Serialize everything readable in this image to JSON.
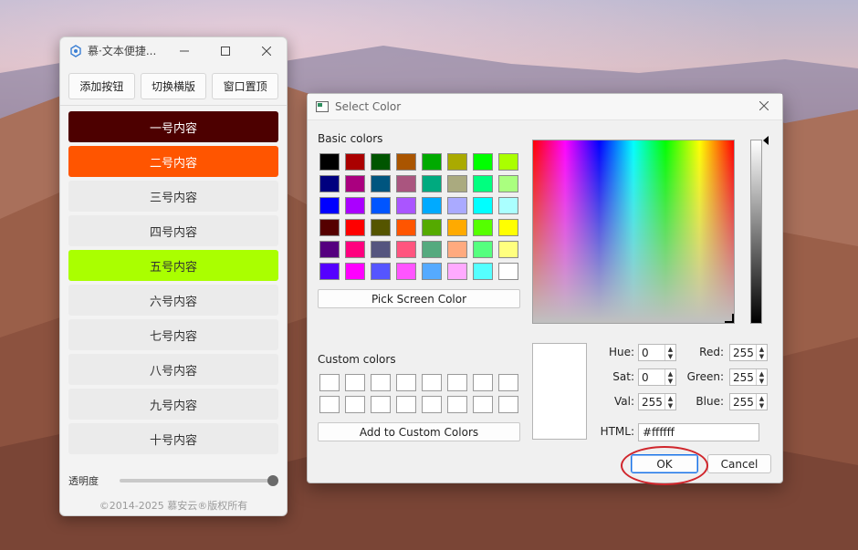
{
  "tool_window": {
    "title": "慕·文本便捷...",
    "buttons": [
      "添加按钮",
      "切换横版",
      "窗口置顶"
    ],
    "items": [
      {
        "label": "一号内容",
        "bg": "#4d0000",
        "fg": "#ffffff"
      },
      {
        "label": "二号内容",
        "bg": "#ff5500",
        "fg": "#ffffff"
      },
      {
        "label": "三号内容",
        "bg": "#ebebeb",
        "fg": "#333333"
      },
      {
        "label": "四号内容",
        "bg": "#ebebeb",
        "fg": "#333333"
      },
      {
        "label": "五号内容",
        "bg": "#aaff00",
        "fg": "#333333"
      },
      {
        "label": "六号内容",
        "bg": "#ebebeb",
        "fg": "#333333"
      },
      {
        "label": "七号内容",
        "bg": "#ebebeb",
        "fg": "#333333"
      },
      {
        "label": "八号内容",
        "bg": "#ebebeb",
        "fg": "#333333"
      },
      {
        "label": "九号内容",
        "bg": "#ebebeb",
        "fg": "#333333"
      },
      {
        "label": "十号内容",
        "bg": "#ebebeb",
        "fg": "#333333"
      }
    ],
    "opacity_label": "透明度",
    "opacity_value": 1.0,
    "copyright": "©2014-2025 慕安云®版权所有"
  },
  "dialog": {
    "title": "Select Color",
    "basic_colors_label": "Basic colors",
    "basic_colors": [
      "#000000",
      "#aa0000",
      "#005500",
      "#aa5500",
      "#00aa00",
      "#aaaa00",
      "#00ff00",
      "#aaff00",
      "#00007f",
      "#aa007f",
      "#00557f",
      "#aa557f",
      "#00aa7f",
      "#aaaa7f",
      "#00ff7f",
      "#aaff7f",
      "#0000ff",
      "#aa00ff",
      "#0055ff",
      "#aa55ff",
      "#00aaff",
      "#aaaaff",
      "#00ffff",
      "#aaffff",
      "#550000",
      "#ff0000",
      "#555500",
      "#ff5500",
      "#55aa00",
      "#ffaa00",
      "#55ff00",
      "#ffff00",
      "#55007f",
      "#ff007f",
      "#55557f",
      "#ff557f",
      "#55aa7f",
      "#ffaa7f",
      "#55ff7f",
      "#ffff7f",
      "#5500ff",
      "#ff00ff",
      "#5555ff",
      "#ff55ff",
      "#55aaff",
      "#ffaaff",
      "#55ffff",
      "#ffffff"
    ],
    "pick_screen_color": "Pick Screen Color",
    "custom_colors_label": "Custom colors",
    "add_to_custom": "Add to Custom Colors",
    "fields": {
      "hue": {
        "label": "Hue:",
        "value": "0"
      },
      "sat": {
        "label": "Sat:",
        "value": "0"
      },
      "val": {
        "label": "Val:",
        "value": "255"
      },
      "red": {
        "label": "Red:",
        "value": "255"
      },
      "green": {
        "label": "Green:",
        "value": "255"
      },
      "blue": {
        "label": "Blue:",
        "value": "255"
      }
    },
    "html_label": "HTML:",
    "html_value": "#ffffff",
    "ok": "OK",
    "cancel": "Cancel"
  }
}
